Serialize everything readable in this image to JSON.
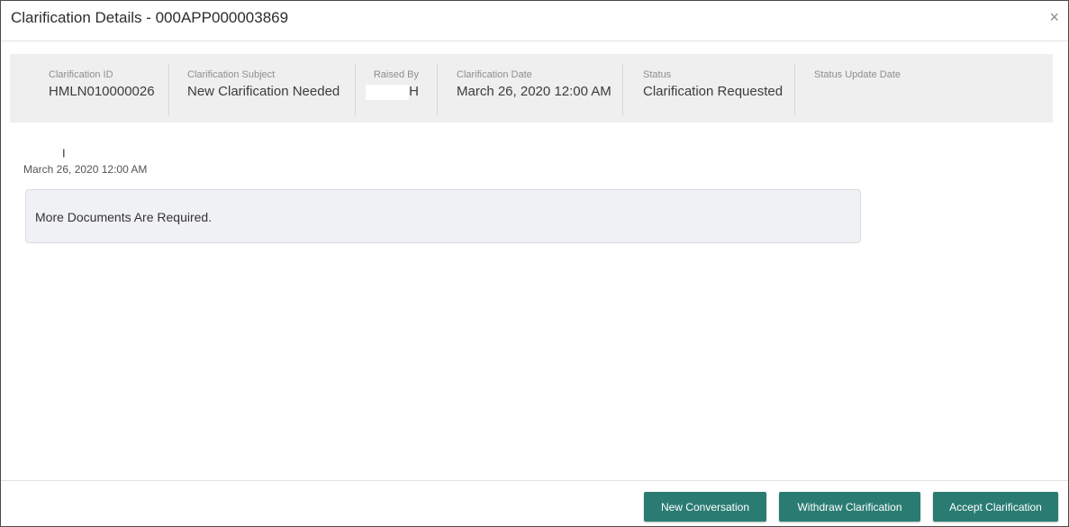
{
  "dialog": {
    "title": "Clarification Details - 000APP000003869",
    "close_label": "×"
  },
  "summary": {
    "clarification_id": {
      "label": "Clarification ID",
      "value": "HMLN010000026"
    },
    "clarification_subject": {
      "label": "Clarification Subject",
      "value": "New Clarification Needed"
    },
    "raised_by": {
      "label": "Raised By",
      "value": "H"
    },
    "clarification_date": {
      "label": "Clarification Date",
      "value": "March 26, 2020 12:00 AM"
    },
    "status": {
      "label": "Status",
      "value": "Clarification Requested"
    },
    "status_update_date": {
      "label": "Status Update Date",
      "value": ""
    }
  },
  "conversation": {
    "author_tail": "I",
    "date": "March 26, 2020 12:00 AM",
    "message": "More Documents Are Required."
  },
  "footer": {
    "new_conversation": "New Conversation",
    "withdraw_clarification": "Withdraw Clarification",
    "accept_clarification": "Accept Clarification"
  },
  "colors": {
    "button_bg": "#2a7c73",
    "summary_bg": "#efefef",
    "message_bg": "#f0f1f4"
  }
}
